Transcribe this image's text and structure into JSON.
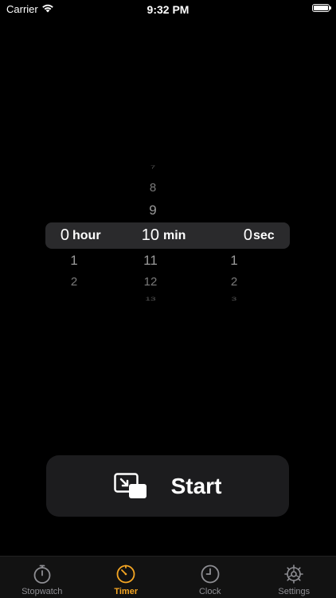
{
  "status_bar": {
    "carrier": "Carrier",
    "time": "9:32 PM"
  },
  "picker": {
    "hour": {
      "above": [],
      "selected": "0",
      "unit": "hour",
      "below": [
        "1",
        "2"
      ]
    },
    "min": {
      "above": [
        "7",
        "8",
        "9"
      ],
      "selected": "10",
      "unit": "min",
      "below": [
        "11",
        "12",
        "13"
      ]
    },
    "sec": {
      "above": [],
      "selected": "0",
      "unit": "sec",
      "below": [
        "1",
        "2",
        "3"
      ]
    }
  },
  "start_button": {
    "label": "Start",
    "icon": "picture-in-picture-icon"
  },
  "tab_bar": {
    "tabs": [
      {
        "label": "Stopwatch",
        "icon": "stopwatch-icon",
        "active": false
      },
      {
        "label": "Timer",
        "icon": "timer-icon",
        "active": true
      },
      {
        "label": "Clock",
        "icon": "clock-icon",
        "active": false
      },
      {
        "label": "Settings",
        "icon": "gear-icon",
        "active": false
      }
    ]
  },
  "colors": {
    "accent": "#f5a623",
    "background": "#000000",
    "button_bg": "#1c1c1e",
    "picker_highlight": "#2a2a2c",
    "inactive": "#8e8e93"
  }
}
